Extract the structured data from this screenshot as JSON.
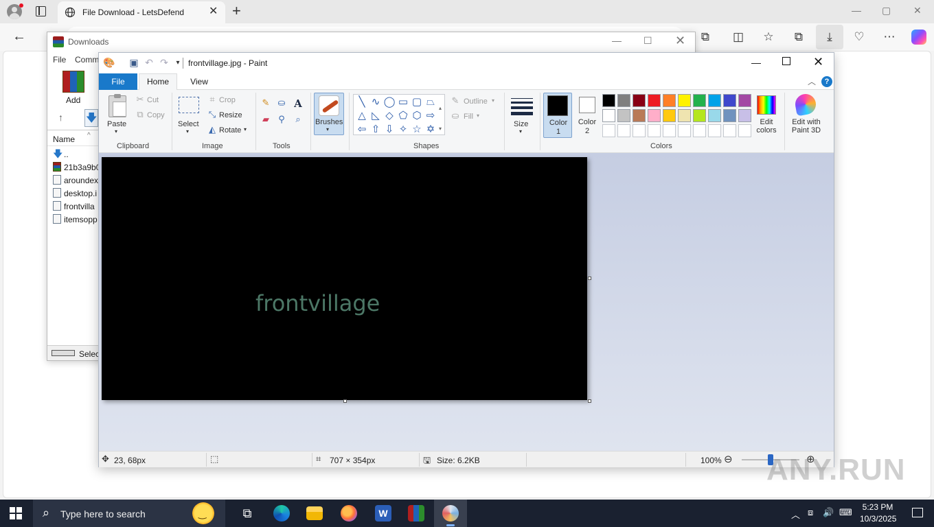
{
  "edge": {
    "tab_title": "File Download - LetsDefend",
    "profile_icon": "profile-icon",
    "window_controls": [
      "—",
      "▢",
      "✕"
    ]
  },
  "winrar": {
    "title": "Downloads",
    "menu": [
      "File",
      "Comm"
    ],
    "add_label": "Add",
    "column_name": "Name",
    "files": [
      "..",
      "21b3a9b0",
      "aroundex",
      "desktop.i",
      "frontvilla",
      "itemsopp"
    ],
    "status_text": "Selec"
  },
  "paint": {
    "title": "frontvillage.jpg - Paint",
    "tabs": {
      "file": "File",
      "home": "Home",
      "view": "View"
    },
    "clipboard": {
      "paste": "Paste",
      "cut": "Cut",
      "copy": "Copy",
      "group": "Clipboard"
    },
    "image": {
      "select": "Select",
      "crop": "Crop",
      "resize": "Resize",
      "rotate": "Rotate",
      "group": "Image"
    },
    "tools": {
      "group": "Tools"
    },
    "brushes": {
      "label": "Brushes"
    },
    "shapes": {
      "outline": "Outline",
      "fill": "Fill",
      "group": "Shapes"
    },
    "size": {
      "label": "Size"
    },
    "colors": {
      "color1_line1": "Color",
      "color1_line2": "1",
      "color2_line1": "Color",
      "color2_line2": "2",
      "group": "Colors",
      "edit_line1": "Edit",
      "edit_line2": "colors",
      "paint3d_line1": "Edit with",
      "paint3d_line2": "Paint 3D",
      "color1_value": "#000000",
      "color2_value": "#ffffff",
      "palette": [
        "#000000",
        "#7f7f7f",
        "#880015",
        "#ed1c24",
        "#ff7f27",
        "#fff200",
        "#22b14c",
        "#00a2e8",
        "#3f48cc",
        "#a349a4",
        "#ffffff",
        "#c3c3c3",
        "#b97a57",
        "#ffaec9",
        "#ffc90e",
        "#efe4b0",
        "#b5e61d",
        "#99d9ea",
        "#7092be",
        "#c8bfe7",
        "#ffffff",
        "#ffffff",
        "#ffffff",
        "#ffffff",
        "#ffffff",
        "#ffffff",
        "#ffffff",
        "#ffffff",
        "#ffffff",
        "#ffffff"
      ]
    },
    "canvas": {
      "text": "frontvillage",
      "background": "#000000",
      "text_color": "#4c7766"
    },
    "status": {
      "cursor_pos": "23, 68px",
      "image_size": "707 × 354px",
      "file_size": "Size: 6.2KB",
      "zoom": "100%"
    }
  },
  "watermark": {
    "text": "ANY.RUN"
  },
  "taskbar": {
    "search_placeholder": "Type here to search",
    "time": "5:23 PM",
    "date": "10/3/2025"
  }
}
